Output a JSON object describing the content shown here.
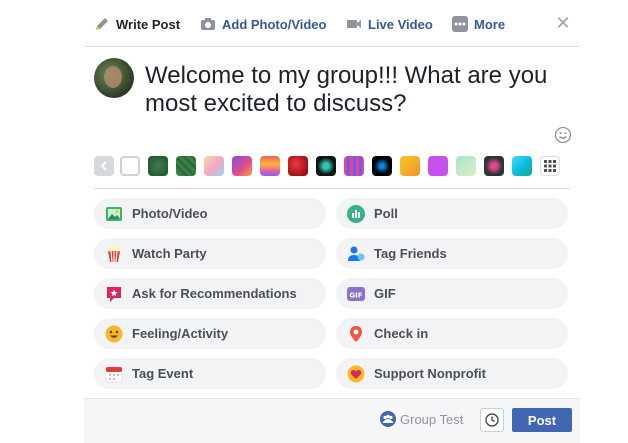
{
  "tabs": {
    "write_post": "Write Post",
    "add_photo_video": "Add Photo/Video",
    "live_video": "Live Video",
    "more": "More"
  },
  "close_icon": "close-icon",
  "message": {
    "text": "Welcome to my group!!! What are you most excited to discuss?"
  },
  "background_swatches": [
    "prev-arrow",
    "plain-white",
    "dark-green",
    "green-texture",
    "pastel-pattern",
    "purple-pink-gradient",
    "rainbow-stripes",
    "red-orb",
    "dark-splash",
    "pink-stripes",
    "black-swirl",
    "yellow-figures",
    "violet",
    "illustration-face",
    "night-pattern",
    "teal-leaves",
    "more-grid"
  ],
  "actions": {
    "photo_video": "Photo/Video",
    "poll": "Poll",
    "watch_party": "Watch Party",
    "tag_friends": "Tag Friends",
    "ask_recommendations": "Ask for Recommendations",
    "gif": "GIF",
    "feeling_activity": "Feeling/Activity",
    "check_in": "Check in",
    "tag_event": "Tag Event",
    "support_nonprofit": "Support Nonprofit"
  },
  "footer": {
    "audience": "Group Test",
    "post_label": "Post"
  },
  "colors": {
    "link": "#365899",
    "primary_button": "#4267b2",
    "pill_bg": "#f2f3f5"
  }
}
